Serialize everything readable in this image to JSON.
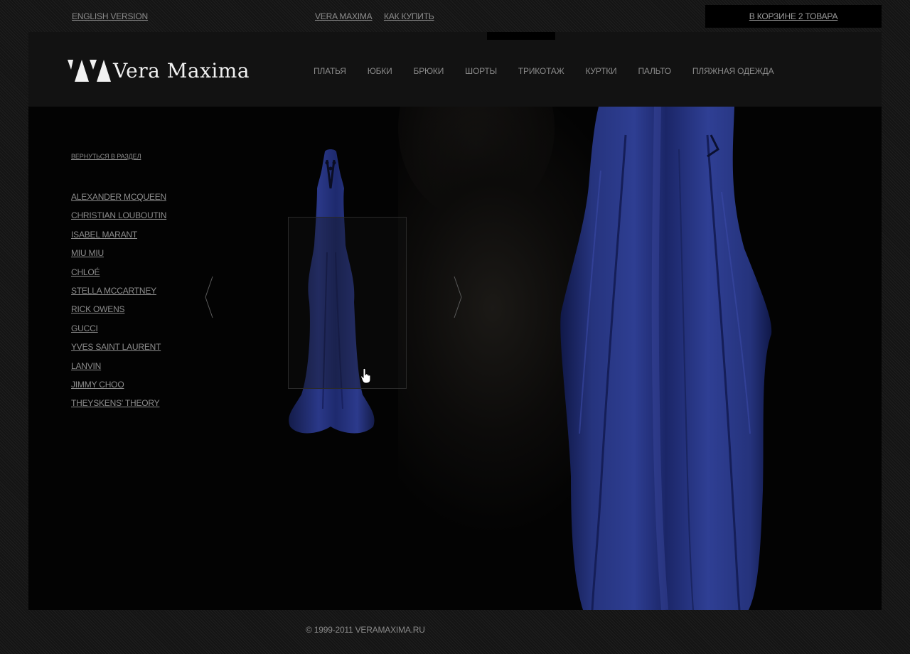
{
  "topbar": {
    "english_version": "ENGLISH VERSION",
    "about": "VERA MAXIMA",
    "how_to_buy": "КАК КУПИТЬ",
    "cart": "В КОРЗИНЕ 2 ТОВАРА"
  },
  "header": {
    "logo_text": "Vera Maxima",
    "nav": [
      "ПЛАТЬЯ",
      "ЮБКИ",
      "БРЮКИ",
      "ШОРТЫ",
      "ТРИКОТАЖ",
      "КУРТКИ",
      "ПАЛЬТО",
      "ПЛЯЖНАЯ ОДЕЖДА"
    ]
  },
  "sidebar": {
    "back_link": "ВЕРНУТЬСЯ В РАЗДЕЛ",
    "brands": [
      "ALEXANDER MCQUEEN",
      "CHRISTIAN LOUBOUTIN",
      "ISABEL MARANT",
      "MIU MIU",
      "CHLOÉ",
      "STELLA MCCARTNEY",
      "RICK OWENS",
      "GUCCI",
      "YVES SAINT LAURENT",
      "LANVIN",
      "JIMMY CHOO",
      "THEYSKENS' THEORY"
    ]
  },
  "footer": {
    "copyright": "© 1999-2011 VERAMAXIMA.RU"
  },
  "colors": {
    "background": "#1a1a1a",
    "panel": "#121212",
    "main": "#030303",
    "dress": "#1f2a66",
    "text": "#8a8a8a",
    "logo": "#f2f2f2"
  },
  "icons": [
    "logo-vm-icon",
    "arrow-left-icon",
    "arrow-right-icon",
    "hand-cursor-icon"
  ]
}
